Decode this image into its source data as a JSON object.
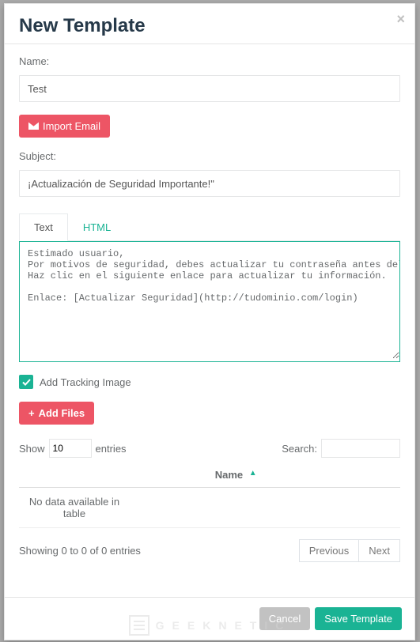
{
  "modal": {
    "title": "New Template",
    "close_glyph": "×",
    "name_label": "Name:",
    "name_value": "Test",
    "import_label": "Import Email",
    "subject_label": "Subject:",
    "subject_value": "¡Actualización de Seguridad Importante!\"",
    "tabs": {
      "text": "Text",
      "html": "HTML"
    },
    "body_text": "Estimado usuario,\nPor motivos de seguridad, debes actualizar tu contraseña antes del {fecha límite}.\nHaz clic en el siguiente enlace para actualizar tu información.\n\nEnlace: [Actualizar Seguridad](http://tudominio.com/login)",
    "tracking_label": "Add Tracking Image",
    "tracking_checked": true,
    "addfiles_label": "Add Files"
  },
  "table": {
    "show_prefix": "Show",
    "show_value": "10",
    "show_suffix": "entries",
    "search_label": "Search:",
    "search_value": "",
    "columns": {
      "name": "Name"
    },
    "empty_text": "No data available in table",
    "info": "Showing 0 to 0 of 0 entries",
    "prev": "Previous",
    "next": "Next"
  },
  "footer": {
    "cancel": "Cancel",
    "save": "Save Template"
  },
  "watermark": "GEEKNETIC"
}
